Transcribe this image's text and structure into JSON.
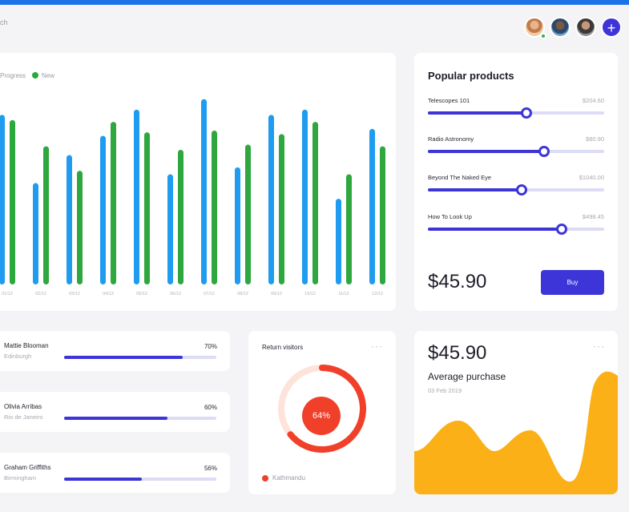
{
  "header": {
    "search_text": "ch",
    "add_label": "+"
  },
  "chart": {
    "legend": [
      "Progress",
      "New"
    ],
    "colors": {
      "blue": "#1f9cf0",
      "green": "#2fa73f"
    }
  },
  "chart_data": {
    "type": "bar",
    "categories": [
      "01/12",
      "02/12",
      "03/12",
      "04/12",
      "05/12",
      "06/12",
      "07/12",
      "08/12",
      "09/12",
      "10/12",
      "11/12",
      "12/12"
    ],
    "series": [
      {
        "name": "Progress",
        "values": [
          97,
          58,
          74,
          85,
          100,
          63,
          106,
          67,
          97,
          100,
          49,
          89
        ]
      },
      {
        "name": "New",
        "values": [
          94,
          79,
          65,
          93,
          87,
          77,
          88,
          80,
          86,
          93,
          63,
          79
        ]
      }
    ],
    "ylim": [
      0,
      110
    ]
  },
  "products": {
    "title": "Popular products",
    "items": [
      {
        "name": "Telescopes 101",
        "price": "$204.60",
        "level": 0.56
      },
      {
        "name": "Radio Astronomy",
        "price": "$80.90",
        "level": 0.66
      },
      {
        "name": "Beyond The Naked Eye",
        "price": "$1040.00",
        "level": 0.53
      },
      {
        "name": "How To Look Up",
        "price": "$498.45",
        "level": 0.76
      }
    ],
    "total": "$45.90",
    "buy_label": "Buy"
  },
  "users": [
    {
      "name": "Mattie Blooman",
      "city": "Edinburgh",
      "pct": "70%",
      "level": 0.78
    },
    {
      "name": "Olivia Arribas",
      "city": "Rio de Janeiro",
      "pct": "60%",
      "level": 0.68
    },
    {
      "name": "Graham Griffiths",
      "city": "Birmingham",
      "pct": "56%",
      "level": 0.51
    }
  ],
  "visitors": {
    "title": "Return visitors",
    "more": "···",
    "percent": "64%",
    "value": 0.64,
    "location": "Kathmandu"
  },
  "average": {
    "amount": "$45.90",
    "label": "Average purchase",
    "date": "03 Feb 2019",
    "more": "···"
  }
}
